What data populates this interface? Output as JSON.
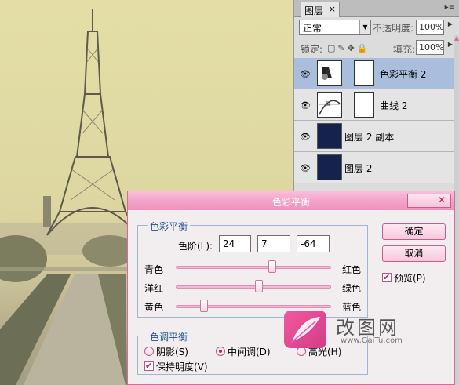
{
  "layers_panel": {
    "tab_label": "图层",
    "tab_close": "×",
    "menu_glyph": "▸≡",
    "blend_mode": "正常",
    "opacity_label": "不透明度:",
    "opacity_value": "100%",
    "lock_label": "锁定:",
    "fill_label": "填充:",
    "fill_value": "100%",
    "layers": [
      {
        "name": "色彩平衡 2",
        "selected": true
      },
      {
        "name": "曲线 2",
        "selected": false
      },
      {
        "name": "图层 2 副本",
        "selected": false
      },
      {
        "name": "图层 2",
        "selected": false
      }
    ]
  },
  "dialog": {
    "title": "色彩平衡",
    "close_glyph": "✕",
    "color_balance_group": "色彩平衡",
    "levels_label": "色阶(L):",
    "levels": [
      "24",
      "7",
      "-64"
    ],
    "sliders": [
      {
        "left": "青色",
        "right": "红色",
        "value": 24
      },
      {
        "left": "洋红",
        "right": "绿色",
        "value": 7
      },
      {
        "left": "黄色",
        "right": "蓝色",
        "value": -64
      }
    ],
    "tone_group": "色调平衡",
    "tone_options": [
      {
        "label": "阴影(S)",
        "selected": false
      },
      {
        "label": "中间调(D)",
        "selected": true
      },
      {
        "label": "高光(H)",
        "selected": false
      }
    ],
    "preserve_luminosity": "保持明度(V)",
    "ok_label": "确定",
    "cancel_label": "取消",
    "preview_label": "预览(P)"
  },
  "watermark": {
    "text": "改图网",
    "url": "www.GaiTu.com"
  },
  "colors": {
    "dialog_title": "#f3a3c8",
    "selected_layer": "#a8bedc",
    "accent": "#c11f5f"
  }
}
